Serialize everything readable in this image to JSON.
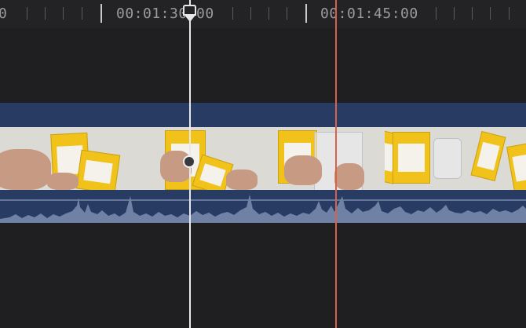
{
  "timeline": {
    "ruler": {
      "left_partial_label": "0",
      "timecode_a": "00:01:30:00",
      "timecode_b": "00:01:45:00"
    },
    "clip": {
      "frames": [
        "frame-1",
        "frame-2",
        "frame-3",
        "frame-4",
        "frame-5"
      ]
    },
    "colors": {
      "background": "#232325",
      "clip_accent": "#283b63",
      "waveform": "#6f82a6",
      "playhead": "#e8e8ea",
      "skimmer": "#d9614a"
    }
  }
}
